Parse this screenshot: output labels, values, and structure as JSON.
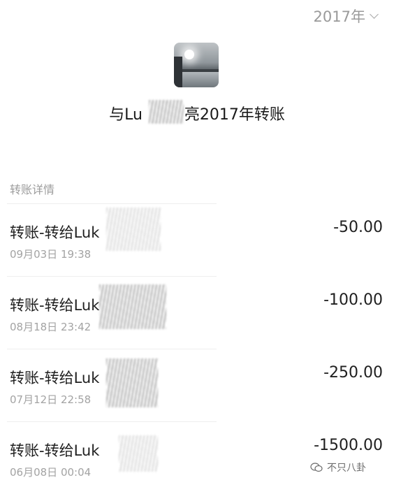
{
  "year_select": {
    "label": "2017年"
  },
  "title": {
    "prefix": "与Lu",
    "suffix": "亮2017年转账"
  },
  "section": {
    "label": "转账详情"
  },
  "transactions": [
    {
      "desc": "转账-转给Luk",
      "time": "09月03日 19:38",
      "amount": "-50.00"
    },
    {
      "desc": "转账-转给Luk",
      "time": "08月18日 23:42",
      "amount": "-100.00"
    },
    {
      "desc": "转账-转给Luk",
      "time": "07月12日 22:58",
      "amount": "-250.00"
    },
    {
      "desc": "转账-转给Luk",
      "time": "06月08日 00:04",
      "amount": "-1500.00"
    }
  ],
  "watermark": {
    "text": "不只八卦"
  },
  "colors": {
    "muted": "#9c9c9c",
    "text": "#1a1a1a"
  }
}
